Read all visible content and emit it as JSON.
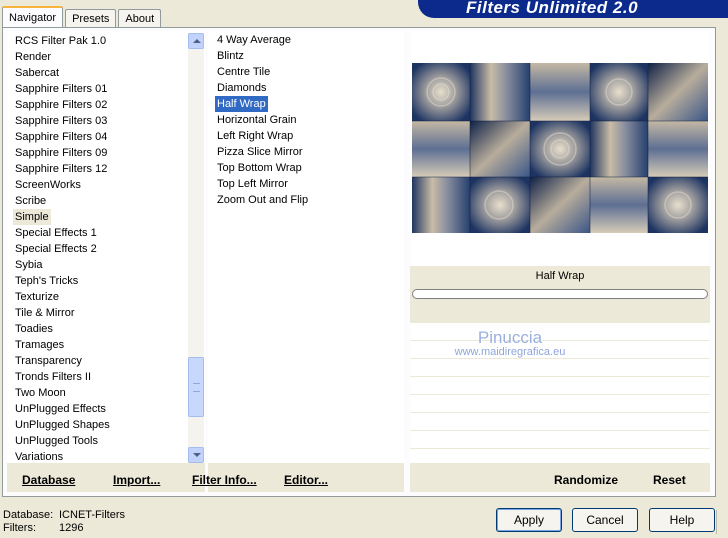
{
  "tabs": [
    "Navigator",
    "Presets",
    "About"
  ],
  "banner_title": "Filters Unlimited 2.0",
  "categories": [
    "RCS Filter Pak 1.0",
    "Render",
    "Sabercat",
    "Sapphire Filters 01",
    "Sapphire Filters 02",
    "Sapphire Filters 03",
    "Sapphire Filters 04",
    "Sapphire Filters 09",
    "Sapphire Filters 12",
    "ScreenWorks",
    "Scribe",
    "Simple",
    "Special Effects 1",
    "Special Effects 2",
    "Sybia",
    "Teph's Tricks",
    "Texturize",
    "Tile & Mirror",
    "Toadies",
    "Tramages",
    "Transparency",
    "Tronds Filters II",
    "Two Moon",
    "UnPlugged Effects",
    "UnPlugged Shapes",
    "UnPlugged Tools",
    "Variations"
  ],
  "selected_category": "Simple",
  "filters": [
    "4 Way Average",
    "Blintz",
    "Centre Tile",
    "Diamonds",
    "Half Wrap",
    "Horizontal Grain",
    "Left Right Wrap",
    "Pizza Slice Mirror",
    "Top Bottom Wrap",
    "Top Left Mirror",
    "Zoom Out and Flip"
  ],
  "selected_filter": "Half Wrap",
  "left_buttons": {
    "database": "Database",
    "import": "Import..."
  },
  "mid_buttons": {
    "filter_info": "Filter Info...",
    "editor": "Editor..."
  },
  "right_buttons": {
    "randomize": "Randomize",
    "reset": "Reset"
  },
  "preview": {
    "filter_name": "Half Wrap"
  },
  "watermark": {
    "line1": "Pinuccia",
    "line2": "www.maidiregrafica.eu"
  },
  "status": {
    "database_label": "Database:",
    "database_value": "ICNET-Filters",
    "filters_label": "Filters:",
    "filters_value": "1296"
  },
  "dialog_buttons": {
    "apply": "Apply",
    "cancel": "Cancel",
    "help": "Help"
  },
  "colors": {
    "selection": "#316ac5",
    "banner": "#0b2a8c",
    "dialog_bg": "#ece9d8"
  }
}
